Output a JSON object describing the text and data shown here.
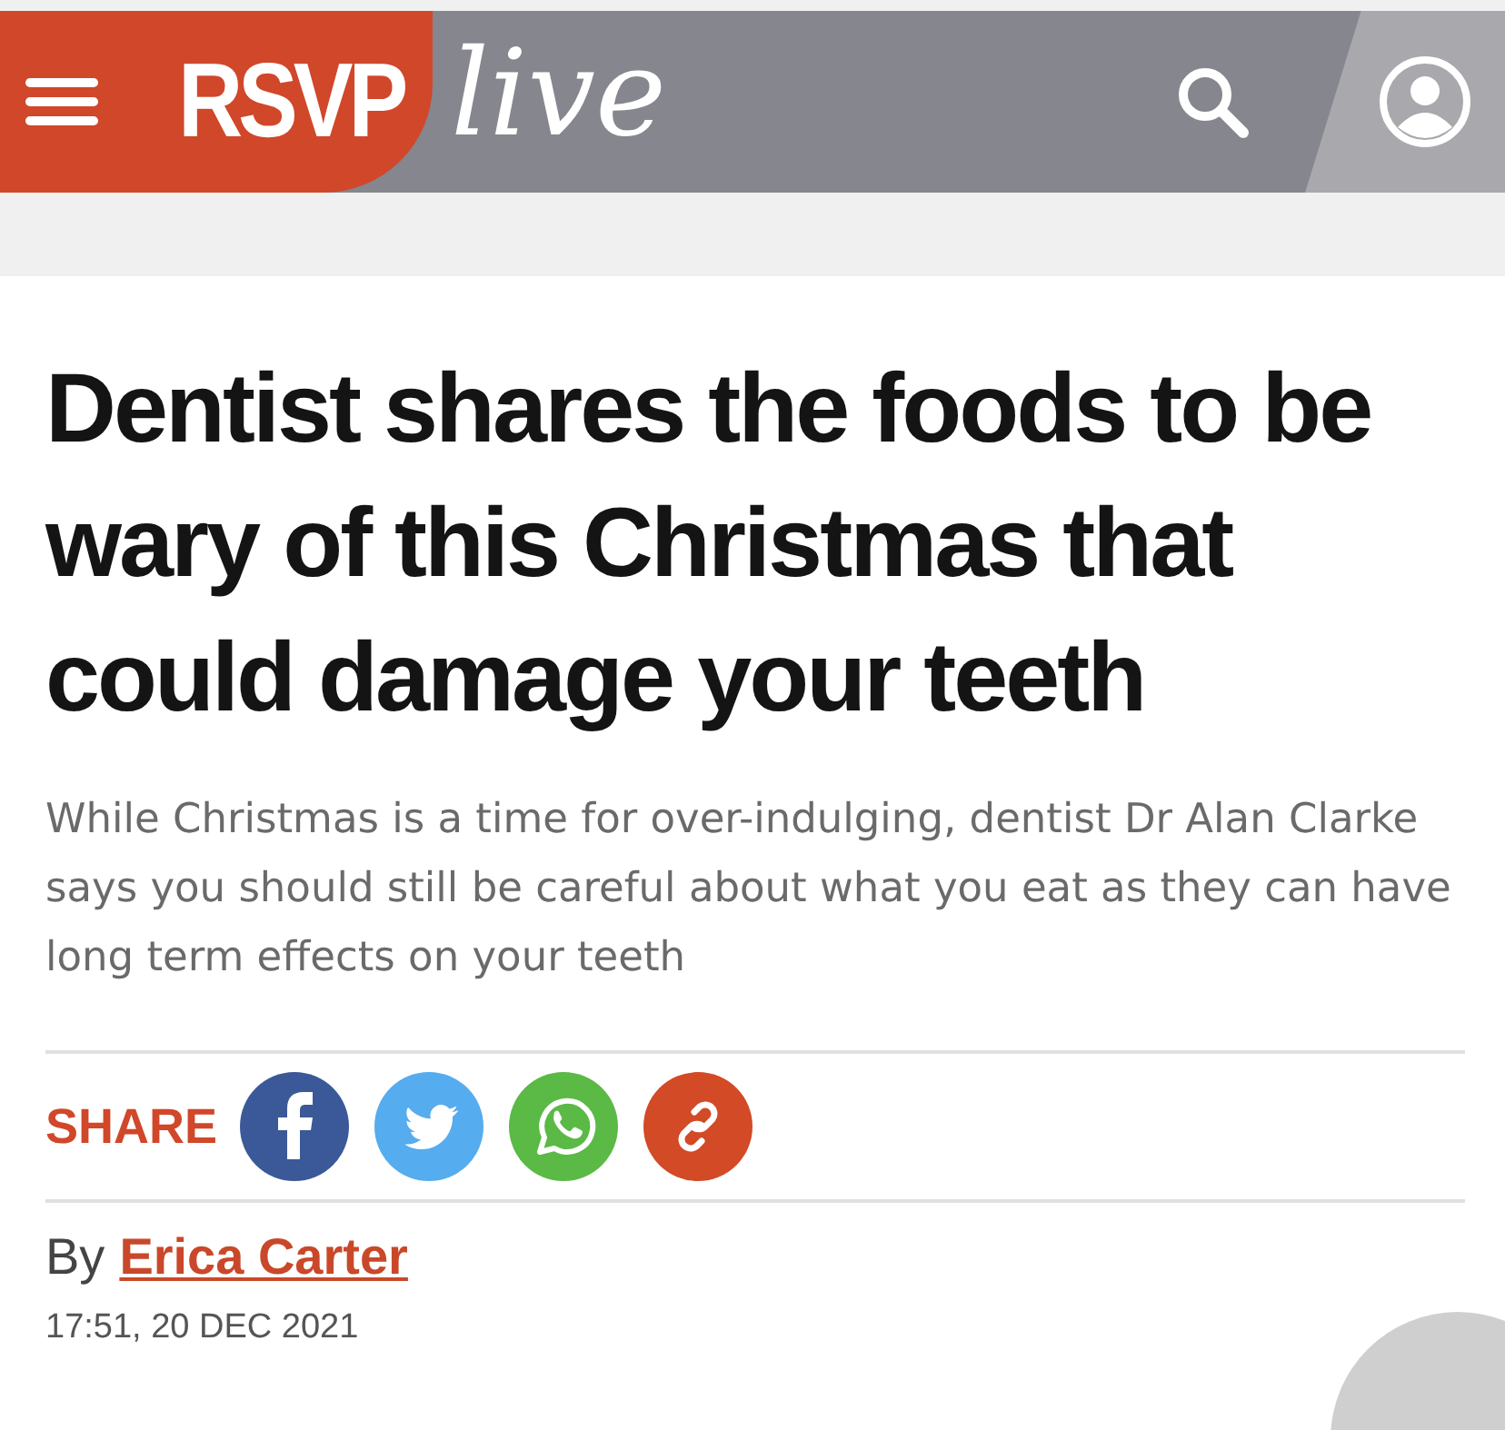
{
  "header": {
    "logo": {
      "main": "RSVP",
      "script": "live"
    }
  },
  "article": {
    "headline": "Dentist shares the foods to be wary of this Christmas that could damage your teeth",
    "summary": "While Christmas is a time for over-indulging, dentist Dr Alan Clarke says you should still be careful about what you eat as they can have long term effects on your teeth",
    "share": {
      "label": "SHARE",
      "buttons": [
        {
          "kind": "facebook",
          "color": "#3b5998"
        },
        {
          "kind": "twitter",
          "color": "#55acee"
        },
        {
          "kind": "whatsapp",
          "color": "#5bb946"
        },
        {
          "kind": "link",
          "color": "#d24a26"
        }
      ]
    },
    "byline": {
      "prefix": "By",
      "author": "Erica Carter"
    },
    "timestamp": "17:51, 20 DEC 2021"
  }
}
